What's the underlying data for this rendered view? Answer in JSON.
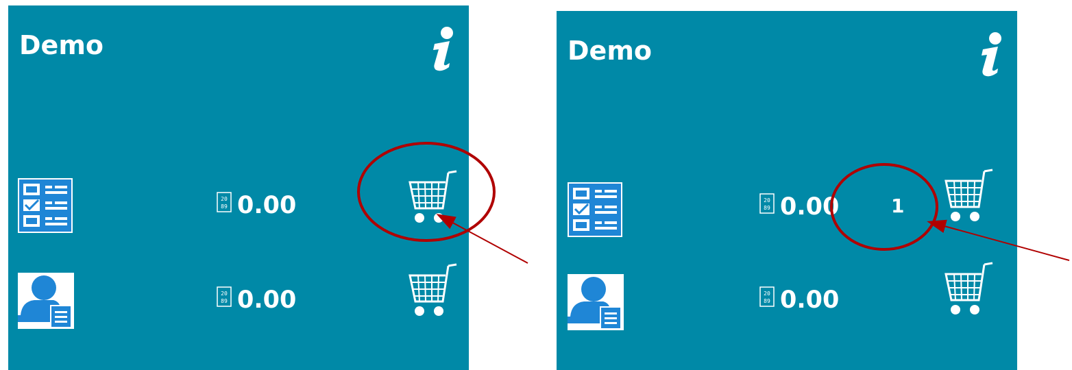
{
  "panels": [
    {
      "title": "Demo",
      "rows": [
        {
          "icon": "checklist-icon",
          "amount": "0.00",
          "cart_count": ""
        },
        {
          "icon": "user-list-icon",
          "amount": "0.00",
          "cart_count": ""
        }
      ]
    },
    {
      "title": "Demo",
      "rows": [
        {
          "icon": "checklist-icon",
          "amount": "0.00",
          "cart_count": "1"
        },
        {
          "icon": "user-list-icon",
          "amount": "0.00",
          "cart_count": ""
        }
      ]
    }
  ],
  "colors": {
    "panel_background": "#0089a7",
    "text": "#ffffff",
    "icon_blue": "#1f86d6",
    "annotation_red": "#b00000"
  },
  "icons": {
    "info": "info-icon",
    "number": "number-icon",
    "cart": "shopping-cart-icon"
  }
}
